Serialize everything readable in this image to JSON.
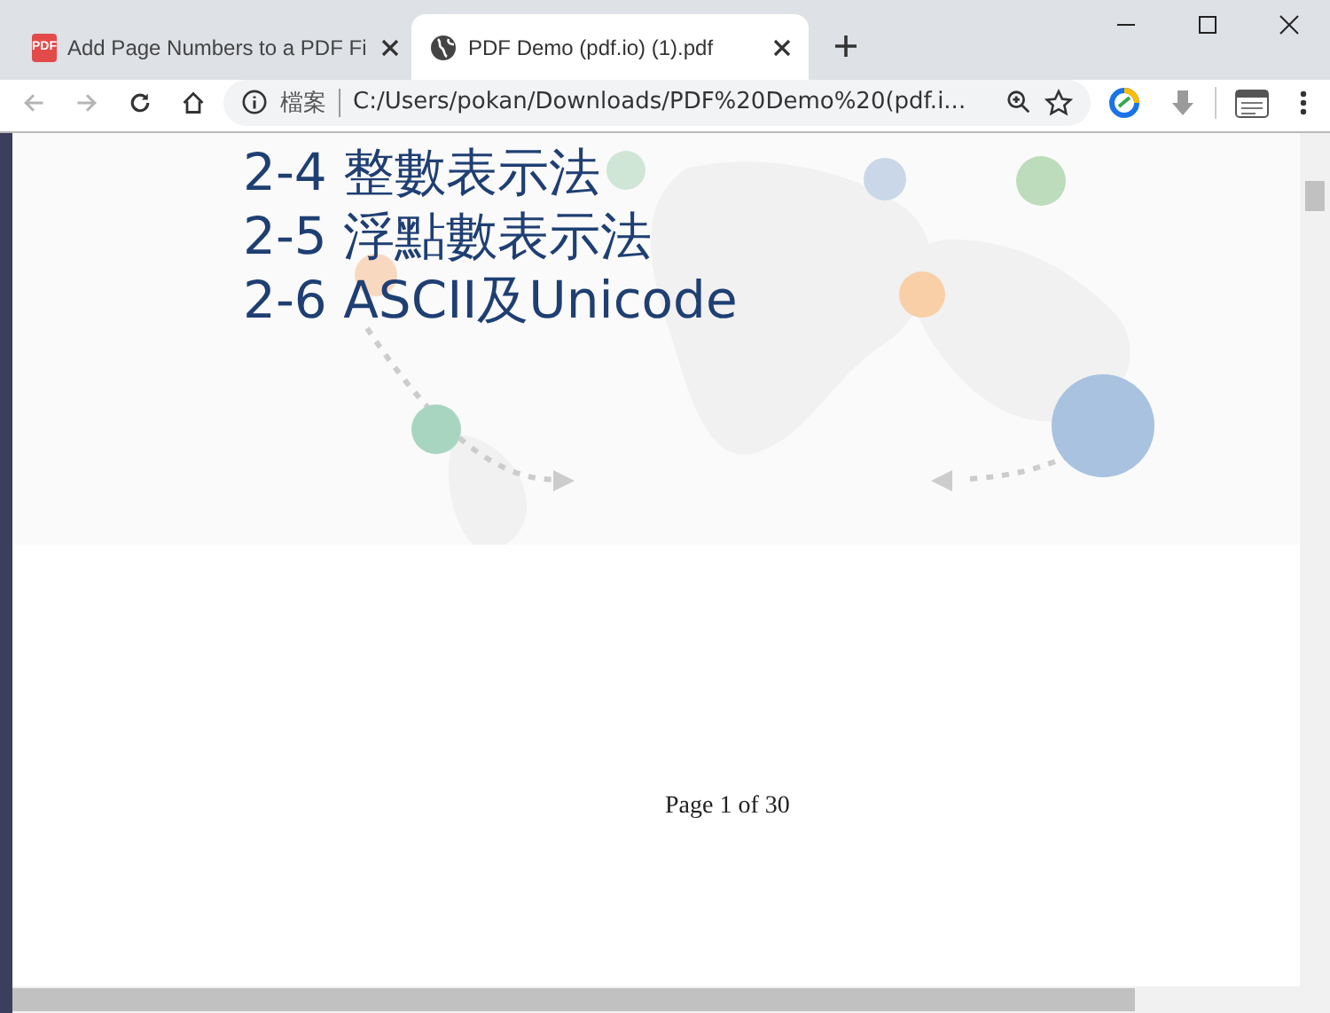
{
  "tabs": [
    {
      "title": "Add Page Numbers to a PDF Fi",
      "kind": "pdf",
      "icon_text": "PDF",
      "selected": false
    },
    {
      "title": "PDF Demo (pdf.io) (1).pdf",
      "kind": "web",
      "selected": true
    }
  ],
  "toolbar": {
    "back_disabled": true,
    "forward_disabled": true,
    "security_label": "檔案",
    "url": "C:/Users/pokan/Downloads/PDF%20Demo%20(pdf.i..."
  },
  "document": {
    "contents_lines": [
      "2-4 整數表示法",
      "2-5 浮點數表示法",
      "2-6 ASCII及Unicode"
    ],
    "footer": "Page 1 of 30"
  }
}
